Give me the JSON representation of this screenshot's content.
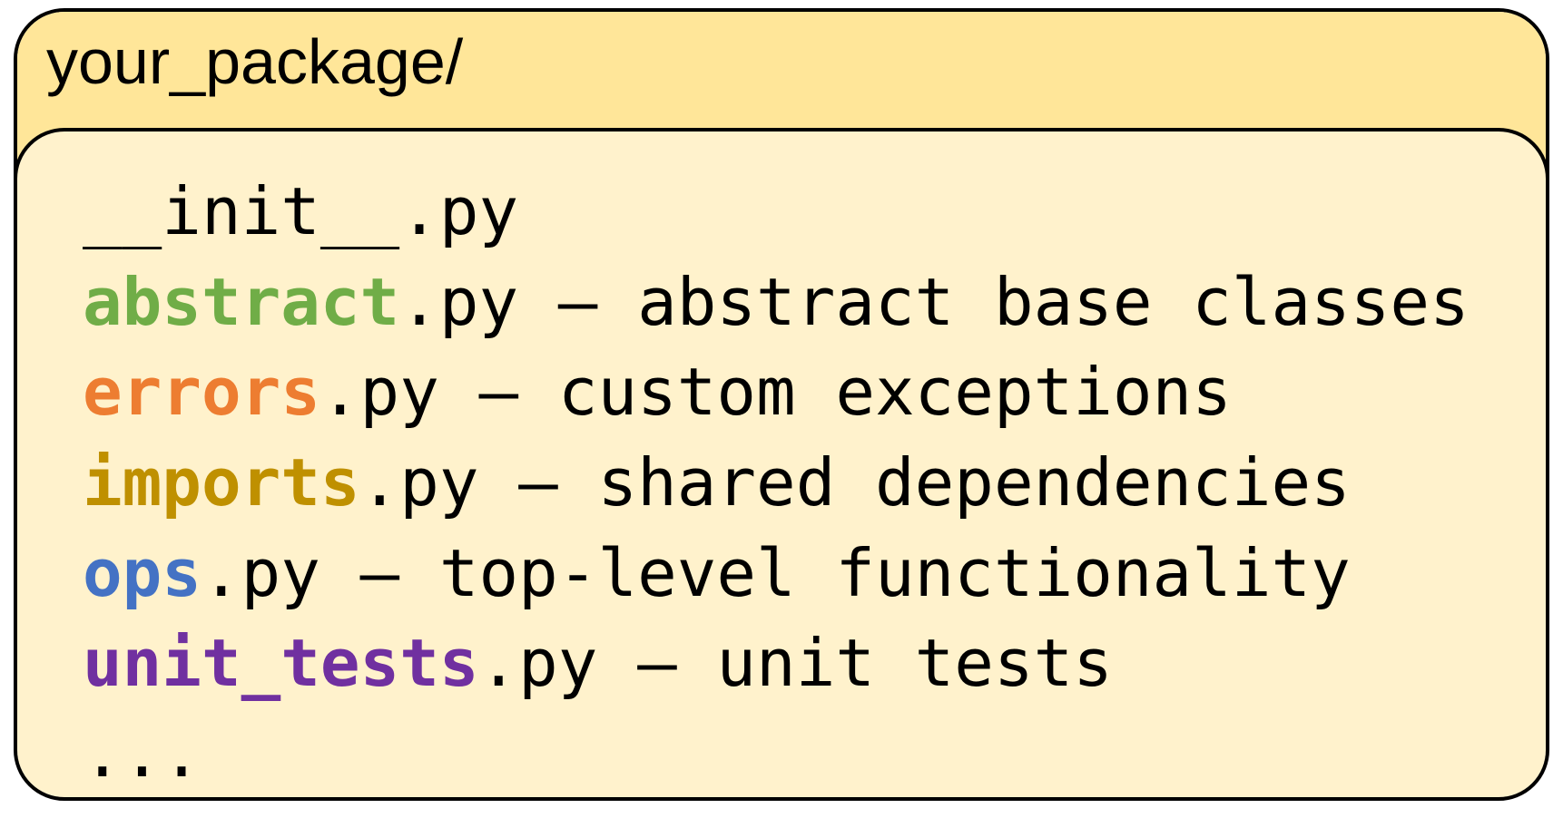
{
  "colors": {
    "tab_background": "#ffe699",
    "body_background": "#fff2cc",
    "border": "#000000",
    "text": "#000000"
  },
  "folder": {
    "title": "your_package/"
  },
  "files": [
    {
      "stem": "",
      "ext": "__init__.py",
      "sep": "",
      "desc": "",
      "color": "#000000"
    },
    {
      "stem": "abstract",
      "ext": ".py",
      "sep": " – ",
      "desc": "abstract base classes",
      "color": "#70ad47"
    },
    {
      "stem": "errors",
      "ext": ".py",
      "sep": " – ",
      "desc": "custom exceptions",
      "color": "#ed7d31"
    },
    {
      "stem": "imports",
      "ext": ".py",
      "sep": " – ",
      "desc": "shared dependencies",
      "color": "#bf9000"
    },
    {
      "stem": "ops",
      "ext": ".py",
      "sep": " – ",
      "desc": "top-level functionality",
      "color": "#4472c4"
    },
    {
      "stem": "unit_tests",
      "ext": ".py",
      "sep": " – ",
      "desc": "unit tests",
      "color": "#7030a0"
    },
    {
      "stem": "",
      "ext": "...",
      "sep": "",
      "desc": "",
      "color": "#000000"
    }
  ]
}
